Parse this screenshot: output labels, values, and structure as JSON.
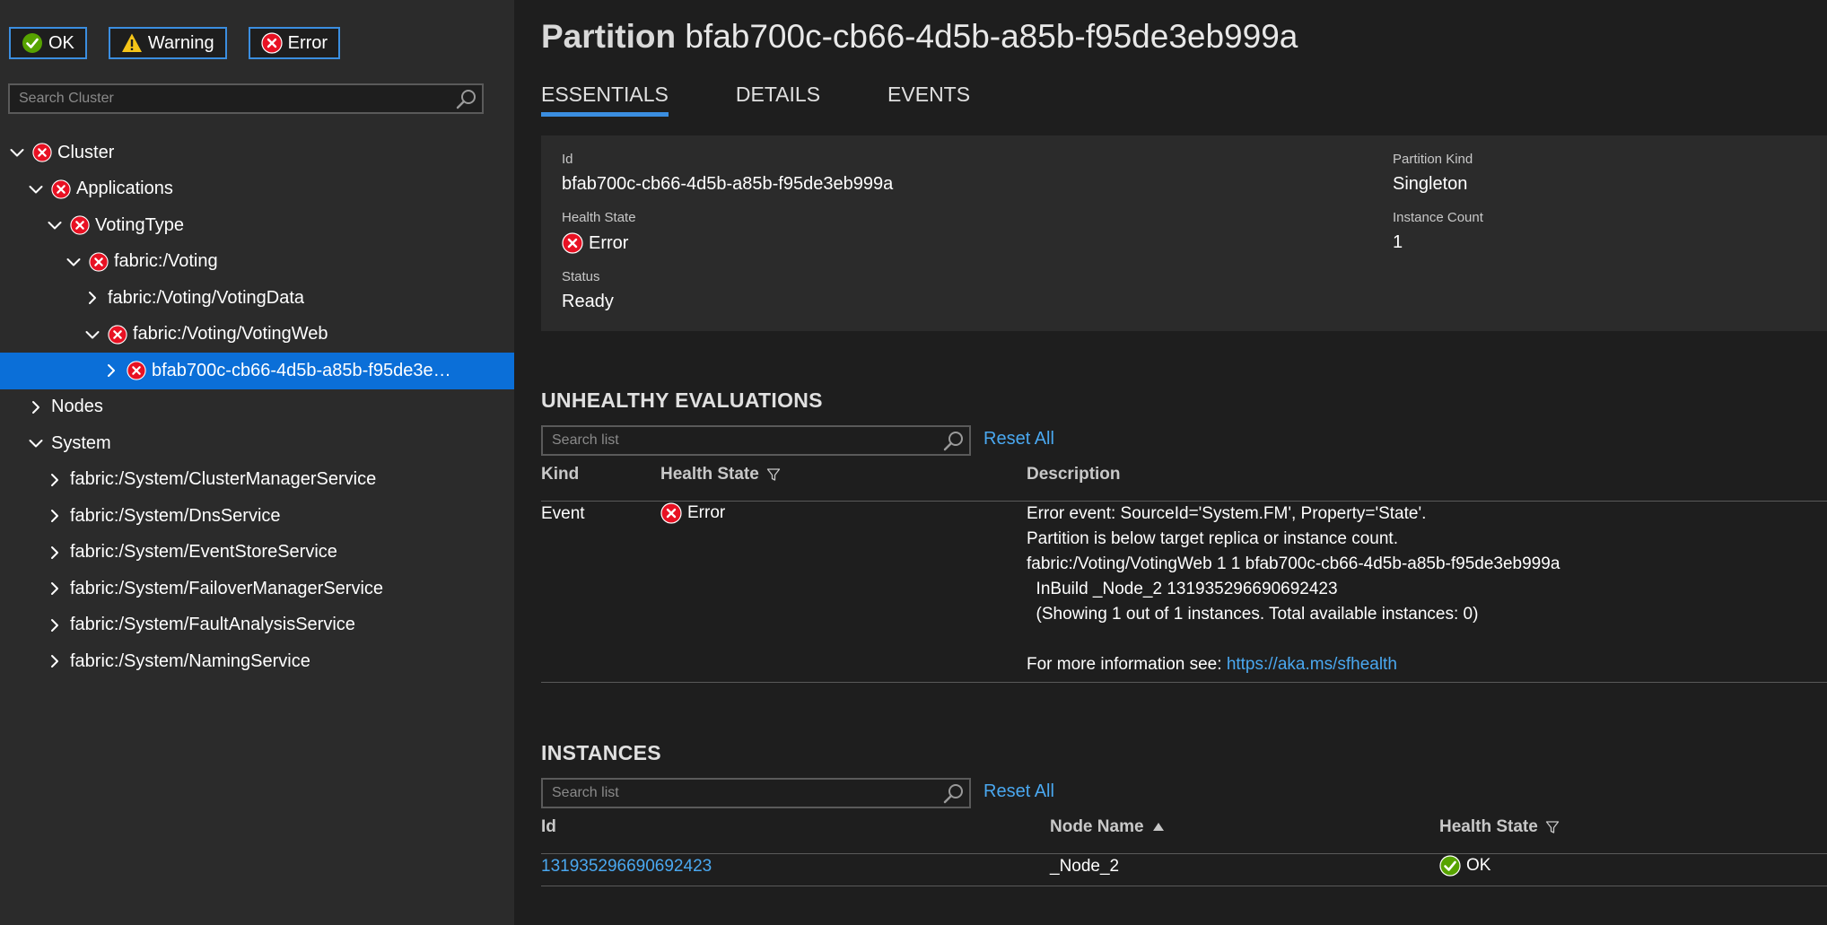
{
  "filters": {
    "ok_label": "OK",
    "warning_label": "Warning",
    "error_label": "Error"
  },
  "search_cluster": {
    "placeholder": "Search Cluster"
  },
  "tree": [
    {
      "label": "Cluster",
      "health": "error",
      "expanded": true,
      "level": 0,
      "selected": false
    },
    {
      "label": "Applications",
      "health": "error",
      "expanded": true,
      "level": 1,
      "selected": false
    },
    {
      "label": "VotingType",
      "health": "error",
      "expanded": true,
      "level": 2,
      "selected": false
    },
    {
      "label": "fabric:/Voting",
      "health": "error",
      "expanded": true,
      "level": 3,
      "selected": false
    },
    {
      "label": "fabric:/Voting/VotingData",
      "health": "none",
      "expanded": false,
      "level": 4,
      "selected": false
    },
    {
      "label": "fabric:/Voting/VotingWeb",
      "health": "error",
      "expanded": true,
      "level": 4,
      "selected": false
    },
    {
      "label": "bfab700c-cb66-4d5b-a85b-f95de3e…",
      "health": "error",
      "expanded": false,
      "level": 5,
      "selected": true
    },
    {
      "label": "Nodes",
      "health": "none",
      "expanded": false,
      "level": 1,
      "selected": false
    },
    {
      "label": "System",
      "health": "none",
      "expanded": true,
      "level": 1,
      "selected": false
    },
    {
      "label": "fabric:/System/ClusterManagerService",
      "health": "none",
      "expanded": false,
      "level": 2,
      "selected": false
    },
    {
      "label": "fabric:/System/DnsService",
      "health": "none",
      "expanded": false,
      "level": 2,
      "selected": false
    },
    {
      "label": "fabric:/System/EventStoreService",
      "health": "none",
      "expanded": false,
      "level": 2,
      "selected": false
    },
    {
      "label": "fabric:/System/FailoverManagerService",
      "health": "none",
      "expanded": false,
      "level": 2,
      "selected": false
    },
    {
      "label": "fabric:/System/FaultAnalysisService",
      "health": "none",
      "expanded": false,
      "level": 2,
      "selected": false
    },
    {
      "label": "fabric:/System/NamingService",
      "health": "none",
      "expanded": false,
      "level": 2,
      "selected": false
    }
  ],
  "header": {
    "title_prefix": "Partition",
    "title_id": "bfab700c-cb66-4d5b-a85b-f95de3eb999a"
  },
  "tabs": [
    {
      "label": "ESSENTIALS",
      "active": true
    },
    {
      "label": "DETAILS",
      "active": false
    },
    {
      "label": "EVENTS",
      "active": false
    }
  ],
  "essentials": {
    "id_label": "Id",
    "id_value": "bfab700c-cb66-4d5b-a85b-f95de3eb999a",
    "health_label": "Health State",
    "health_value": "Error",
    "status_label": "Status",
    "status_value": "Ready",
    "kind_label": "Partition Kind",
    "kind_value": "Singleton",
    "count_label": "Instance Count",
    "count_value": "1"
  },
  "unhealthy": {
    "title": "UNHEALTHY EVALUATIONS",
    "search_placeholder": "Search list",
    "reset_label": "Reset All",
    "col_kind": "Kind",
    "col_health": "Health State",
    "col_desc": "Description",
    "row": {
      "kind": "Event",
      "health": "Error",
      "desc_lines": [
        "Error event: SourceId='System.FM', Property='State'.",
        "Partition is below target replica or instance count.",
        "fabric:/Voting/VotingWeb 1 1 bfab700c-cb66-4d5b-a85b-f95de3eb999a",
        "  InBuild _Node_2 131935296690692423",
        "  (Showing 1 out of 1 instances. Total available instances: 0)",
        ""
      ],
      "more_info_prefix": "For more information see: ",
      "more_info_link": "https://aka.ms/sfhealth"
    }
  },
  "instances": {
    "title": "INSTANCES",
    "search_placeholder": "Search list",
    "reset_label": "Reset All",
    "col_id": "Id",
    "col_node": "Node Name",
    "col_health": "Health State",
    "rows": [
      {
        "id": "131935296690692423",
        "node": "_Node_2",
        "health": "OK"
      }
    ]
  },
  "colors": {
    "accent": "#3b8ee0",
    "selected_bg": "#0b6fd8",
    "link": "#4aa8f0",
    "error": "#e81123",
    "ok": "#57a300",
    "warning": "#f5c518"
  }
}
